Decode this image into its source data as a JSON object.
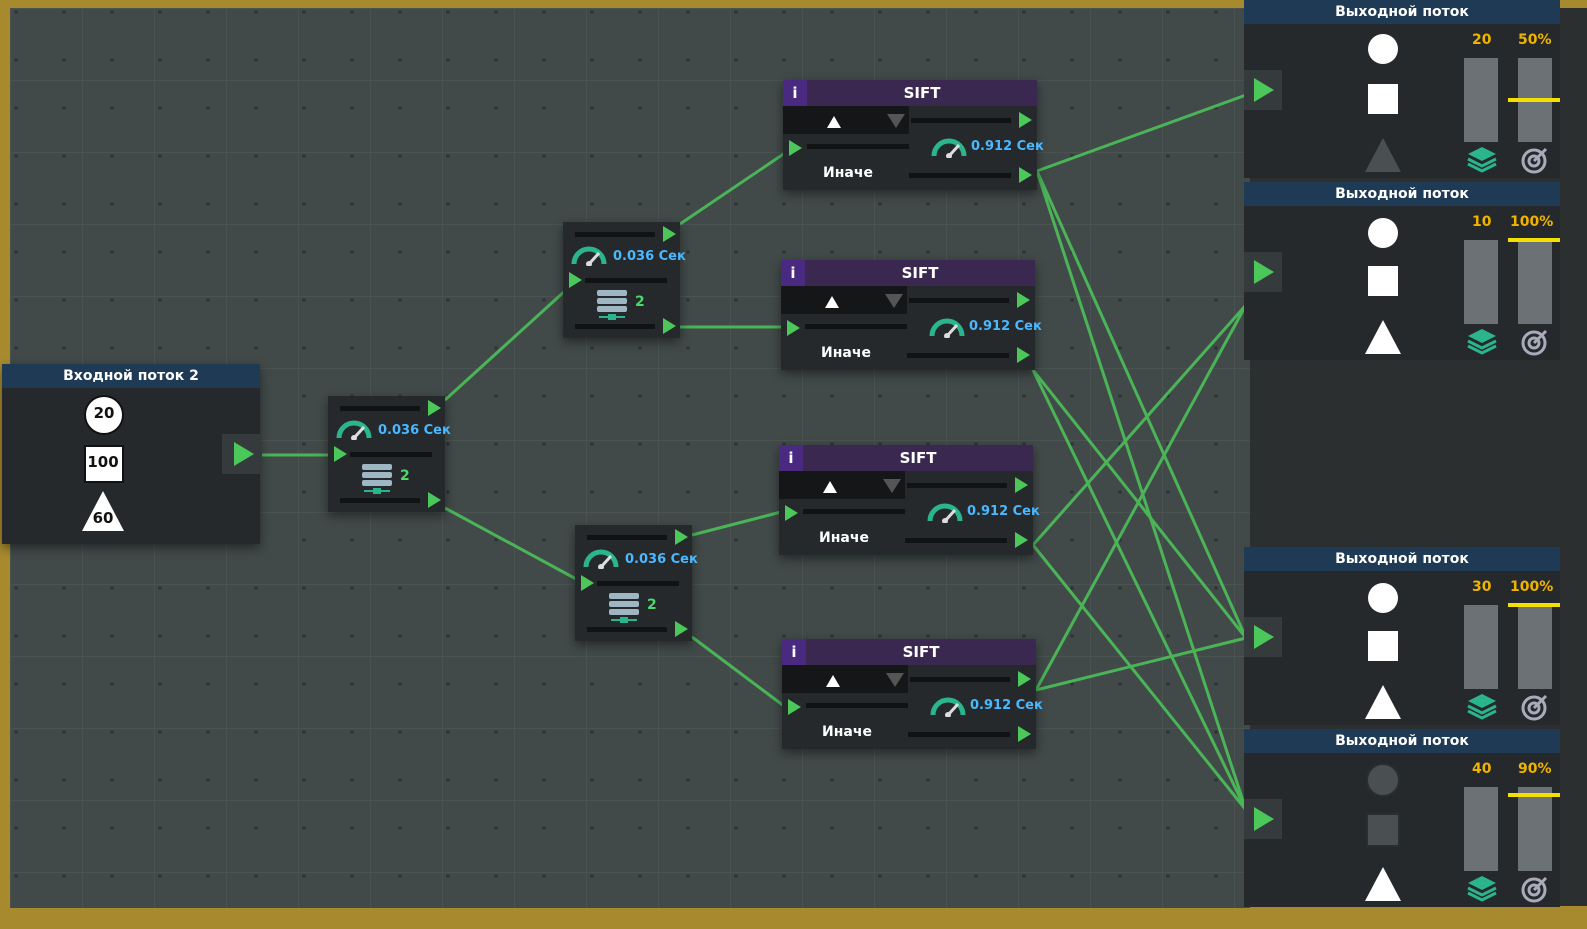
{
  "colors": {
    "wire": "#4cc75a",
    "header": "#1f3a55",
    "sift_header": "#3a2850",
    "speed": "#4ab8ff",
    "count": "#4cd86a",
    "percent": "#f0b400"
  },
  "input_node": {
    "title": "Входной поток 2",
    "circle_count": "20",
    "square_count": "100",
    "triangle_count": "60"
  },
  "splitters": [
    {
      "speed": "0.036 Сек",
      "count": "2"
    },
    {
      "speed": "0.036 Сек",
      "count": "2"
    },
    {
      "speed": "0.036 Сек",
      "count": "2"
    }
  ],
  "sifts": [
    {
      "info": "i",
      "title": "SIFT",
      "speed": "0.912 Сек",
      "else_label": "Иначе",
      "filter_icon": "triangle-icon"
    },
    {
      "info": "i",
      "title": "SIFT",
      "speed": "0.912 Сек",
      "else_label": "Иначе",
      "filter_icon": "triangle-icon"
    },
    {
      "info": "i",
      "title": "SIFT",
      "speed": "0.912 Сек",
      "else_label": "Иначе",
      "filter_icon": "triangle-icon"
    },
    {
      "info": "i",
      "title": "SIFT",
      "speed": "0.912 Сек",
      "else_label": "Иначе",
      "filter_icon": "triangle-icon"
    }
  ],
  "outputs": [
    {
      "title": "Выходной поток",
      "count": "20",
      "percent": "50%",
      "accepts": [
        "circle",
        "square"
      ],
      "rejects": [
        "triangle"
      ]
    },
    {
      "title": "Выходной поток",
      "count": "10",
      "percent": "100%",
      "accepts": [
        "circle",
        "square",
        "triangle"
      ],
      "rejects": []
    },
    {
      "title": "Выходной поток",
      "count": "30",
      "percent": "100%",
      "accepts": [
        "circle",
        "square",
        "triangle"
      ],
      "rejects": []
    },
    {
      "title": "Выходной поток",
      "count": "40",
      "percent": "90%",
      "accepts": [
        "triangle"
      ],
      "rejects": [
        "circle",
        "square"
      ]
    }
  ]
}
